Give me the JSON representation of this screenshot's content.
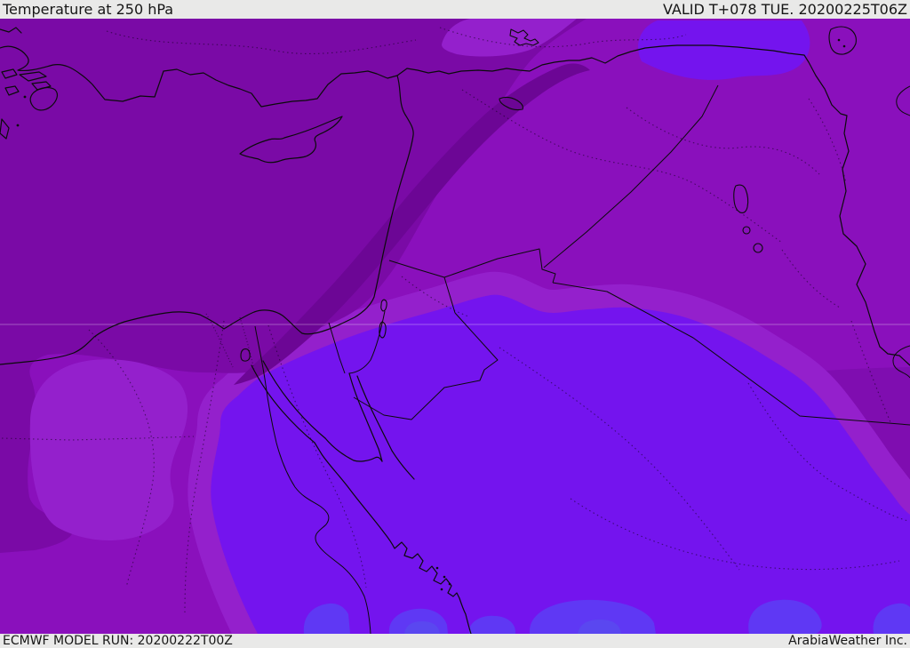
{
  "header": {
    "title": "Temperature at 250 hPa",
    "valid_label": "VALID T+078 TUE. 20200225T06Z"
  },
  "footer": {
    "model_run_label": "ECMWF MODEL RUN: 20200222T00Z",
    "brand": "ArabiaWeather Inc."
  },
  "map": {
    "palette": {
      "bar_bg": "#e9e9e8",
      "bar_text": "#161616",
      "coastline": "#0b0b0b",
      "band_coldest_streak": "#6c0695",
      "band_dark": "#7a0aa6",
      "band_medium": "#8a10bc",
      "band_medium_dark": "#7f0db0",
      "band_light": "#9420cc",
      "band_violet": "#7414ee",
      "band_blue_violet": "#5f38f4",
      "band_periwinkle": "#5a47f0",
      "gridline": "rgba(255,255,255,0.25)"
    }
  }
}
